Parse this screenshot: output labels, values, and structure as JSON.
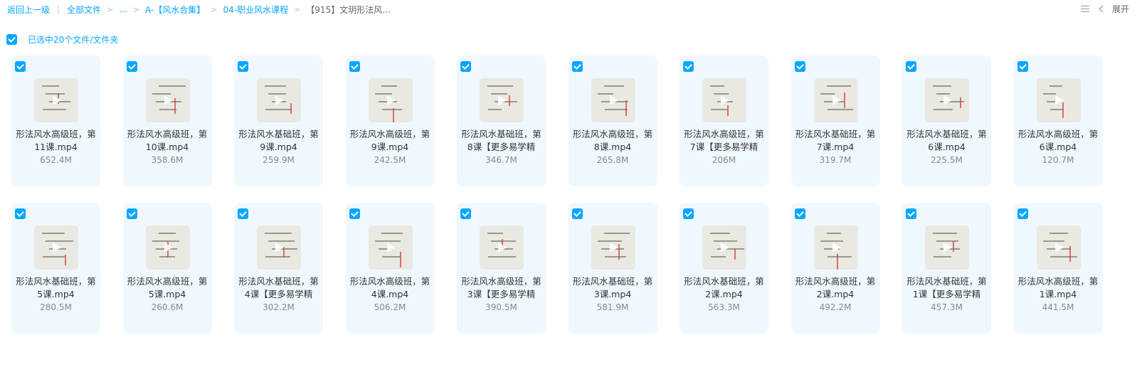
{
  "breadcrumb": {
    "back": "返回上一级",
    "all_files": "全部文件",
    "ellipsis": "...",
    "level1": "A-【风水合集】",
    "level2": "04-职业风水课程",
    "current": "【915】文玥形法风..."
  },
  "toolbar": {
    "expand_label": "展开",
    "list_view_icon": "list-view-icon",
    "collapse_icon": "chevron-left-icon"
  },
  "selection": {
    "label": "已选中20个文件/文件夹",
    "checked": true
  },
  "files": [
    {
      "name": "形法风水高级班，第11课.mp4",
      "size": "652.4M"
    },
    {
      "name": "形法风水高级班，第10课.mp4",
      "size": "358.6M"
    },
    {
      "name": "形法风水基础班，第9课.mp4",
      "size": "259.9M"
    },
    {
      "name": "形法风水高级班，第9课.mp4",
      "size": "242.5M"
    },
    {
      "name": "形法风水基础班，第8课【更多易学精",
      "size": "346.7M"
    },
    {
      "name": "形法风水高级班，第8课.mp4",
      "size": "265.8M"
    },
    {
      "name": "形法风水高级班，第7课【更多易学精",
      "size": "206M"
    },
    {
      "name": "形法风水基础班，第7课.mp4",
      "size": "319.7M"
    },
    {
      "name": "形法风水基础班，第6课.mp4",
      "size": "225.5M"
    },
    {
      "name": "形法风水高级班，第6课.mp4",
      "size": "120.7M"
    },
    {
      "name": "形法风水基础班，第5课.mp4",
      "size": "280.5M"
    },
    {
      "name": "形法风水高级班，第5课.mp4",
      "size": "260.6M"
    },
    {
      "name": "形法风水基础班，第4课【更多易学精",
      "size": "302.2M"
    },
    {
      "name": "形法风水高级班，第4课.mp4",
      "size": "506.2M"
    },
    {
      "name": "形法风水高级班，第3课【更多易学精",
      "size": "390.5M"
    },
    {
      "name": "形法风水基础班，第3课.mp4",
      "size": "581.9M"
    },
    {
      "name": "形法风水基础班，第2课.mp4",
      "size": "563.3M"
    },
    {
      "name": "形法风水高级班，第2课.mp4",
      "size": "492.2M"
    },
    {
      "name": "形法风水基础班，第1课【更多易学精",
      "size": "457.3M"
    },
    {
      "name": "形法风水高级班，第1课.mp4",
      "size": "441.5M"
    }
  ],
  "colors": {
    "accent": "#06a7ff",
    "card_bg": "#f0f8ff"
  }
}
